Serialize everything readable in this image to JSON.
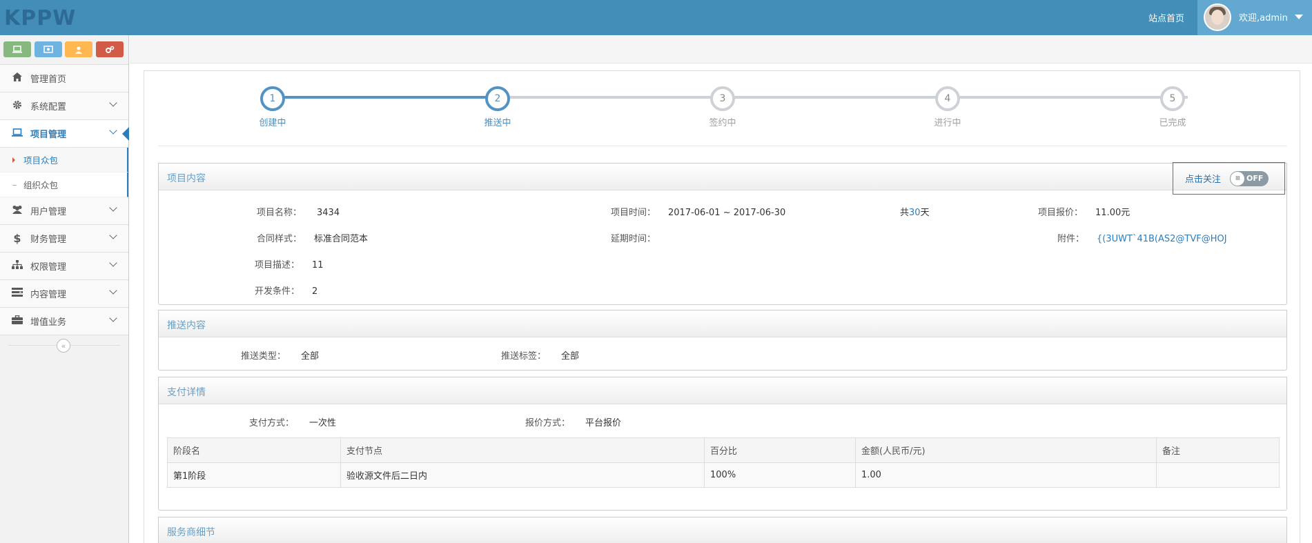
{
  "header": {
    "logo": "KPPW",
    "site_home": "站点首页",
    "welcome": "欢迎,admin"
  },
  "sidebar": {
    "shortcuts": [
      "laptop-icon",
      "eye-icon",
      "user-icon",
      "cogs-icon"
    ],
    "items": [
      {
        "label": "管理首页",
        "icon": "home-icon"
      },
      {
        "label": "系统配置",
        "icon": "gear-icon"
      },
      {
        "label": "项目管理",
        "icon": "laptop-icon"
      },
      {
        "label": "用户管理",
        "icon": "users-icon"
      },
      {
        "label": "财务管理",
        "icon": "dollar-icon"
      },
      {
        "label": "权限管理",
        "icon": "sitemap-icon"
      },
      {
        "label": "内容管理",
        "icon": "list-icon"
      },
      {
        "label": "增值业务",
        "icon": "briefcase-icon"
      }
    ],
    "sub_items": [
      "项目众包",
      "组织众包"
    ],
    "collapse": "«"
  },
  "steps": [
    {
      "num": "1",
      "label": "创建中"
    },
    {
      "num": "2",
      "label": "推送中"
    },
    {
      "num": "3",
      "label": "签约中"
    },
    {
      "num": "4",
      "label": "进行中"
    },
    {
      "num": "5",
      "label": "已完成"
    }
  ],
  "project": {
    "title": "项目内容",
    "follow_label": "点击关注",
    "toggle": "OFF",
    "toggle_knob": "III",
    "name_label": "项目名称：",
    "name": "3434",
    "time_label": "项目时间：",
    "time": "2017-06-01 ~ 2017-06-30",
    "days_prefix": "共",
    "days": "30",
    "days_suffix": "天",
    "price_label": "项目报价：",
    "price": "11.00元",
    "contract_label": "合同样式：",
    "contract": "标准合同范本",
    "delay_label": "延期时间：",
    "attach_label": "附件：",
    "attach": "{(3UWT`41B(AS2@TVF@HOJ",
    "desc_label": "项目描述：",
    "desc": "11",
    "cond_label": "开发条件：",
    "cond": "2"
  },
  "push": {
    "title": "推送内容",
    "type_label": "推送类型：",
    "type": "全部",
    "tag_label": "推送标签：",
    "tag": "全部"
  },
  "payment": {
    "title": "支付详情",
    "method_label": "支付方式：",
    "method": "一次性",
    "quote_label": "报价方式：",
    "quote": "平台报价",
    "columns": [
      "阶段名",
      "支付节点",
      "百分比",
      "金额(人民币/元)",
      "备注"
    ],
    "rows": [
      [
        "第1阶段",
        "验收源文件后二日内",
        "100%",
        "1.00",
        ""
      ]
    ]
  },
  "service": {
    "title": "服务商细节"
  },
  "colors": {
    "topbar": "#438eb9",
    "accent": "#2b7dbc",
    "step_done": "#5293c4"
  }
}
